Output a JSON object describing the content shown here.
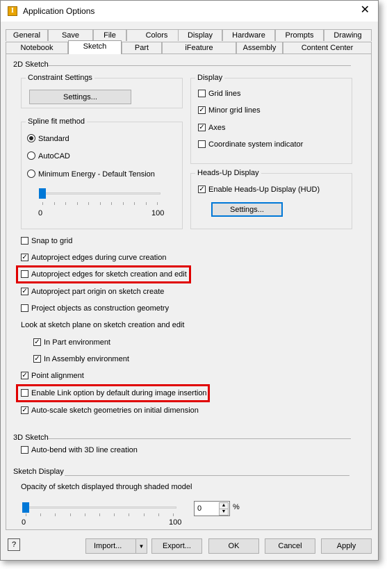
{
  "window": {
    "title": "Application Options",
    "close": "✕"
  },
  "tabs_row1": [
    "General",
    "Save",
    "File",
    "Colors",
    "Display",
    "Hardware",
    "Prompts",
    "Drawing"
  ],
  "tabs_row2": [
    "Notebook",
    "Sketch",
    "Part",
    "iFeature",
    "Assembly",
    "Content Center"
  ],
  "active_tab": "Sketch",
  "sketch2d": {
    "title": "2D Sketch",
    "constraint": {
      "title": "Constraint Settings",
      "button": "Settings..."
    },
    "spline": {
      "title": "Spline fit method",
      "options": [
        "Standard",
        "AutoCAD",
        "Minimum Energy - Default Tension"
      ],
      "selected": 0,
      "slider_min": "0",
      "slider_max": "100",
      "slider_value": 0
    },
    "display": {
      "title": "Display",
      "items": [
        {
          "label": "Grid lines",
          "checked": false
        },
        {
          "label": "Minor grid lines",
          "checked": true
        },
        {
          "label": "Axes",
          "checked": true
        },
        {
          "label": "Coordinate system indicator",
          "checked": false
        }
      ]
    },
    "hud": {
      "title": "Heads-Up Display",
      "enable": {
        "label": "Enable Heads-Up Display (HUD)",
        "checked": true
      },
      "button": "Settings..."
    },
    "options": [
      {
        "label": "Snap to grid",
        "checked": false
      },
      {
        "label": "Autoproject edges during curve creation",
        "checked": true
      },
      {
        "label": "Autoproject edges for sketch creation and edit",
        "checked": false
      },
      {
        "label": "Autoproject part origin on sketch create",
        "checked": true
      },
      {
        "label": "Project objects as construction geometry",
        "checked": false
      }
    ],
    "look_at": {
      "label": "Look at sketch plane on sketch creation and edit",
      "items": [
        {
          "label": "In Part environment",
          "checked": true
        },
        {
          "label": "In Assembly environment",
          "checked": true
        }
      ]
    },
    "options2": [
      {
        "label": "Point alignment",
        "checked": true
      },
      {
        "label": "Enable Link option by default during image insertion",
        "checked": false
      },
      {
        "label": "Auto-scale sketch geometries on initial dimension",
        "checked": true
      }
    ]
  },
  "sketch3d": {
    "title": "3D Sketch",
    "autobend": {
      "label": "Auto-bend with 3D line creation",
      "checked": false
    }
  },
  "sketch_display": {
    "title": "Sketch Display",
    "opacity_label": "Opacity of sketch displayed through shaded model",
    "slider_min": "0",
    "slider_max": "100",
    "slider_value": 0,
    "value": "0",
    "unit": "%"
  },
  "footer": {
    "help": "?",
    "import": "Import...",
    "import_arrow": "▼",
    "export": "Export...",
    "ok": "OK",
    "cancel": "Cancel",
    "apply": "Apply"
  },
  "colors": {
    "highlight": "#e00000",
    "accent": "#0078d7"
  }
}
